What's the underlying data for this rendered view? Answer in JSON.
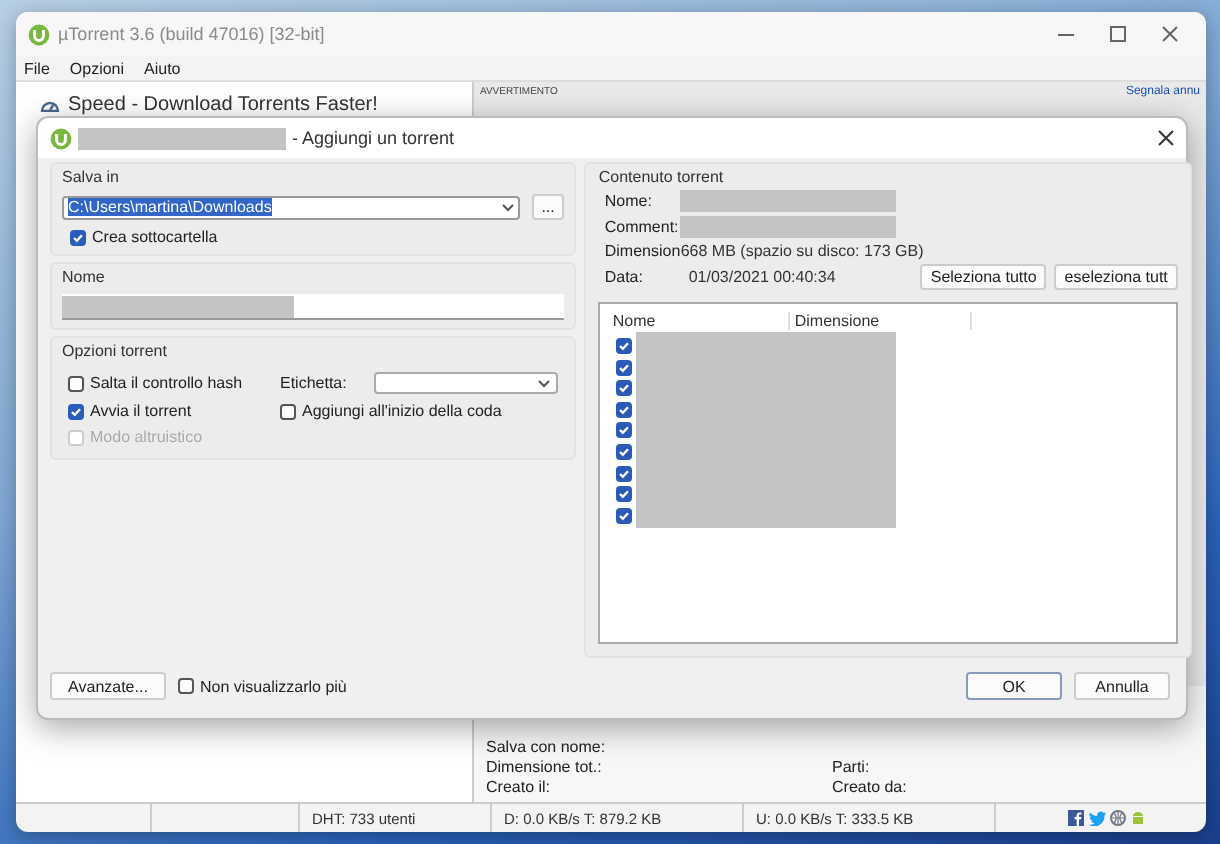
{
  "window": {
    "title": "µTorrent 3.6  (build 47016) [32-bit]"
  },
  "menu": [
    "File",
    "Opzioni",
    "Aiuto"
  ],
  "sidebar": {
    "ad_text": "Speed - Download Torrents Faster!"
  },
  "ad_panel": {
    "label": "AVVERTIMENTO",
    "link": "Segnala annu"
  },
  "details": {
    "rows": [
      [
        "Salva con nome:"
      ],
      [
        "Dimensione tot.:",
        "Parti:"
      ],
      [
        "Creato il:",
        "Creato da:"
      ]
    ]
  },
  "status_bar": [
    "DHT: 733 utenti",
    "D: 0.0 KB/s T: 879.2 KB",
    "U: 0.0 KB/s T: 333.5 KB"
  ],
  "dialog": {
    "title": "- Aggiungi un torrent",
    "save_in": {
      "label": "Salva in",
      "value": "C:\\Users\\martina\\Downloads",
      "browse": "...",
      "subfolder": {
        "label": "Crea sottocartella",
        "checked": true
      }
    },
    "name": {
      "label": "Nome"
    },
    "options": {
      "label": "Opzioni torrent",
      "checks": [
        {
          "label": "Salta il controllo hash",
          "checked": false,
          "disabled": false
        },
        {
          "label": "Avvia il torrent",
          "checked": true,
          "disabled": false
        },
        {
          "label": "Modo altruistico",
          "checked": false,
          "disabled": true
        }
      ],
      "tag_label": "Etichetta:",
      "queue": {
        "label": "Aggiungi all'inizio della coda",
        "checked": false
      }
    },
    "content": {
      "label": "Contenuto torrent",
      "info": [
        {
          "label": "Nome:",
          "kind": "redacted"
        },
        {
          "label": "Comment:",
          "kind": "redacted"
        },
        {
          "label": "Dimension",
          "kind": "text",
          "value": "668 MB (spazio su disco: 173 GB)"
        },
        {
          "label": "Data:",
          "kind": "text",
          "value": "01/03/2021 00:40:34"
        }
      ],
      "select_all": "Seleziona tutto",
      "deselect_all": "eseleziona tutt",
      "columns": [
        "Nome",
        "Dimensione"
      ],
      "files": [
        {
          "checked": true
        },
        {
          "checked": true
        },
        {
          "checked": true
        },
        {
          "checked": true
        },
        {
          "checked": true
        },
        {
          "checked": true
        },
        {
          "checked": true
        },
        {
          "checked": true
        },
        {
          "checked": true
        }
      ]
    },
    "advanced": "Avanzate...",
    "dont_show": {
      "label": "Non visualizzarlo più",
      "checked": false
    },
    "ok": "OK",
    "cancel": "Annulla"
  }
}
